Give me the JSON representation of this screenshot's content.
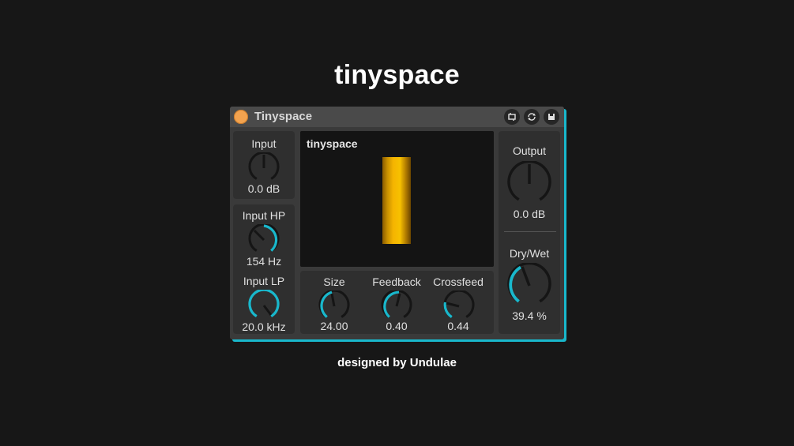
{
  "page": {
    "title": "tinyspace",
    "credit": "designed by Undulae"
  },
  "device": {
    "name": "Tinyspace",
    "accent_color": "#19b8cc",
    "power_color": "#f3a34f",
    "titlebar_icons": [
      "hot-swap-icon",
      "refresh-icon",
      "save-icon"
    ]
  },
  "display": {
    "title": "tinyspace",
    "meter_color": "#f5b400"
  },
  "controls": {
    "input": {
      "label": "Input",
      "value": "0.0 dB"
    },
    "input_hp": {
      "label": "Input HP",
      "value": "154 Hz"
    },
    "input_lp": {
      "label": "Input LP",
      "value": "20.0 kHz"
    },
    "size": {
      "label": "Size",
      "value": "24.00"
    },
    "feedback": {
      "label": "Feedback",
      "value": "0.40"
    },
    "crossfeed": {
      "label": "Crossfeed",
      "value": "0.44"
    },
    "output": {
      "label": "Output",
      "value": "0.0 dB"
    },
    "dry_wet": {
      "label": "Dry/Wet",
      "value": "39.4 %"
    }
  }
}
